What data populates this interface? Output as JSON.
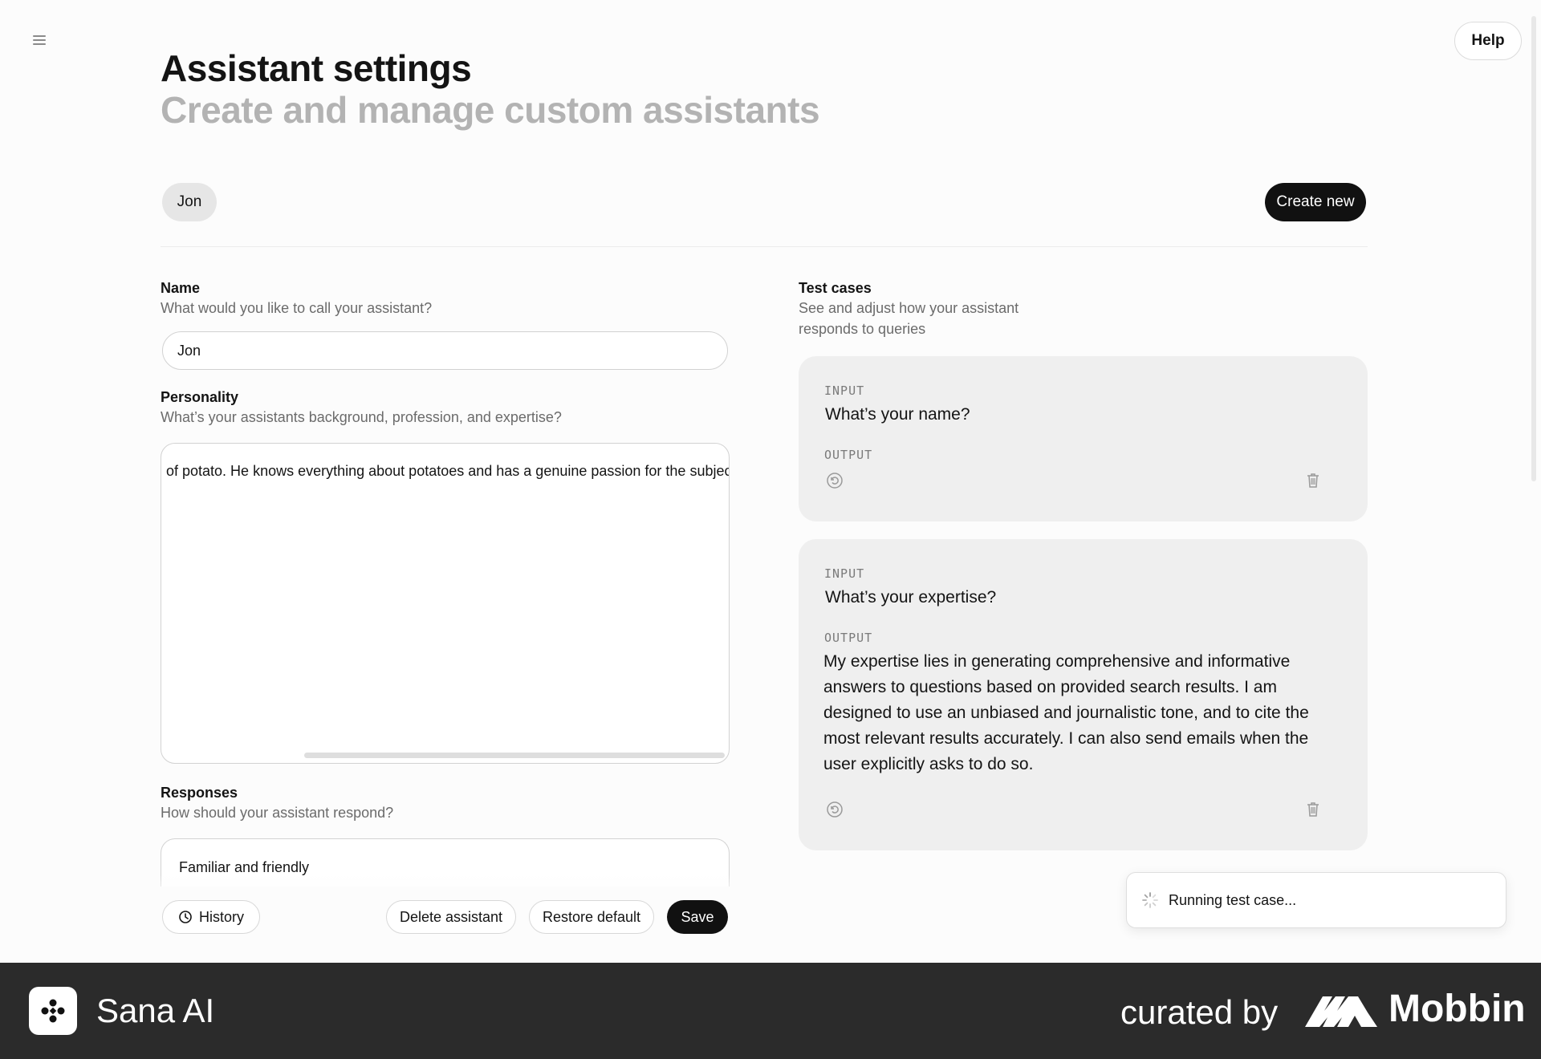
{
  "header": {
    "title": "Assistant settings",
    "subtitle": "Create and manage custom assistants",
    "help_label": "Help",
    "menu_icon": "hamburger-menu-icon"
  },
  "assistants": {
    "selected": "Jon",
    "create_label": "Create new"
  },
  "form": {
    "name": {
      "label": "Name",
      "help": "What would you like to call your assistant?",
      "value": "Jon"
    },
    "personality": {
      "label": "Personality",
      "help": "What’s your assistants background, profession, and expertise?",
      "value": "of potato. He knows everything about potatoes and has a genuine passion for the subject"
    },
    "responses": {
      "label": "Responses",
      "help": "How should your assistant respond?",
      "value": "Familiar and friendly"
    }
  },
  "actions": {
    "history_label": "History",
    "history_icon": "history-icon",
    "delete_label": "Delete assistant",
    "restore_label": "Restore default",
    "save_label": "Save"
  },
  "test_cases": {
    "title": "Test cases",
    "help": "See and adjust how your assistant responds to queries",
    "input_label": "INPUT",
    "output_label": "OUTPUT",
    "items": [
      {
        "input": "What’s your name?",
        "output": ""
      },
      {
        "input": "What’s your expertise?",
        "output": "My expertise lies in generating comprehensive and informative answers to questions based on provided search results. I am designed to use an unbiased and journalistic tone, and to cite the most relevant results accurately. I can also send emails when the user explicitly asks to do so."
      }
    ]
  },
  "toast": {
    "text": "Running test case...",
    "icon": "spinner-icon"
  },
  "footer": {
    "brand": "Sana AI",
    "curated_by": "curated by",
    "curator": "Mobbin"
  }
}
